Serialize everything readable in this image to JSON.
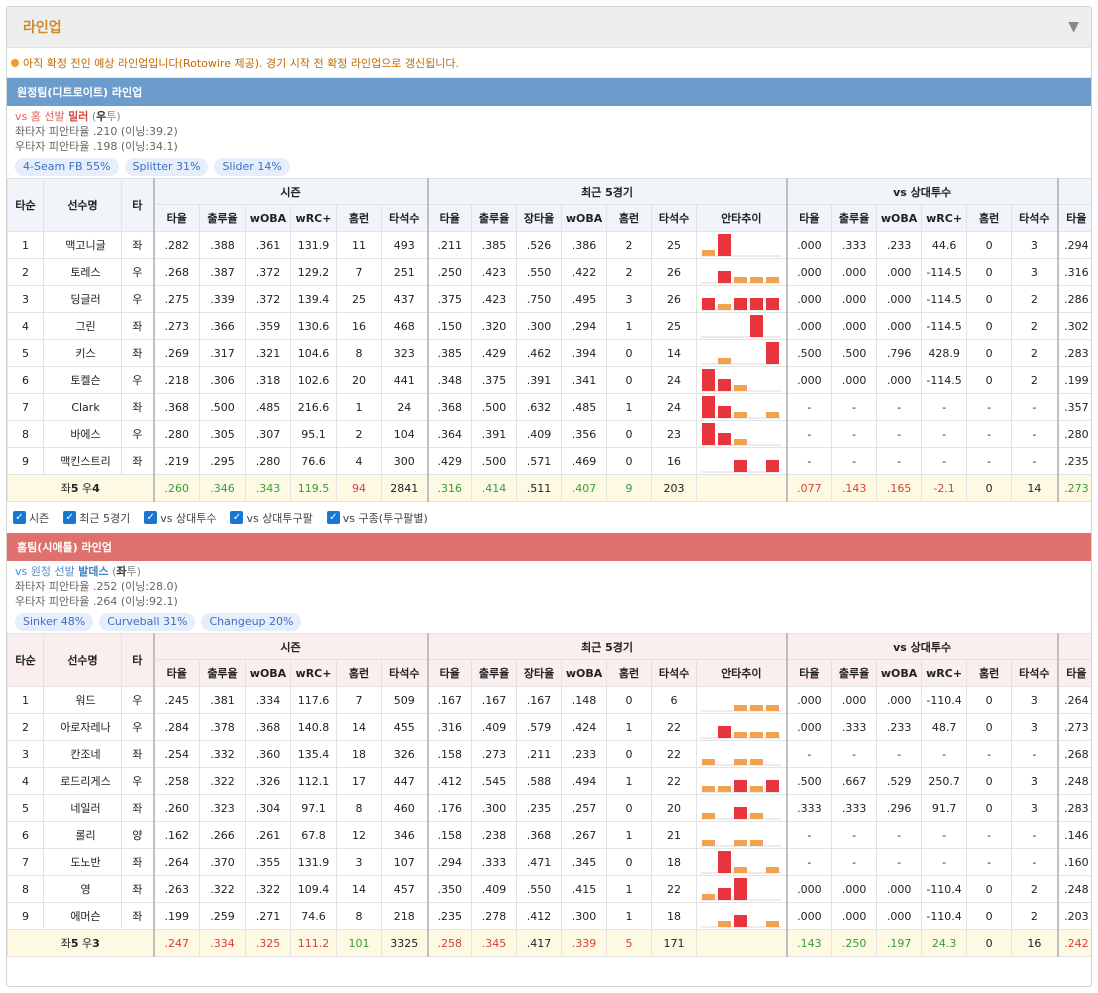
{
  "panel": {
    "title": "라인업",
    "collapse_icon": "▼"
  },
  "notice": "아직 확정 전인 예상 라인업입니다(Rotowire 제공). 경기 시작 전 확정 라인업으로 갱신됩니다.",
  "columns": {
    "group_season": "시즌",
    "group_recent": "최근 5경기",
    "group_vs": "vs 상대투수",
    "batorder": "타순",
    "name": "선수명",
    "hand": "타",
    "season": [
      "타율",
      "출루율",
      "wOBA",
      "wRC+",
      "홈런",
      "타석수"
    ],
    "recent": [
      "타율",
      "출루율",
      "장타율",
      "wOBA",
      "홈런",
      "타석수",
      "안타추이"
    ],
    "vs": [
      "타율",
      "출루율",
      "wOBA",
      "wRC+",
      "홈런",
      "타석수"
    ],
    "extra": "타율"
  },
  "toggles": [
    "시즌",
    "최근 5경기",
    "vs 상대투수",
    "vs 상대투구팔",
    "vs 구종(투구팔별)"
  ],
  "colors": {
    "bar_red": "#e8353b",
    "bar_orange": "#f0a24e",
    "away_bar": "#6b9ccb",
    "home_bar": "#e0706d"
  },
  "away": {
    "header": "원정팀(디트로이트) 라인업",
    "pitcher": {
      "vs": "vs 홈 선발",
      "name": "밀러",
      "hand_open": "(",
      "hand": "우",
      "hand_close": "투)",
      "line1": "좌타자 피안타율 .210 (이닝:39.2)",
      "line2": "우타자 피안타율 .198 (이닝:34.1)"
    },
    "chips": [
      "4-Seam FB 55%",
      "Splitter 31%",
      "Slider 14%"
    ],
    "rows": [
      {
        "o": "1",
        "n": "맥고니글",
        "h": "좌",
        "s": [
          ".282",
          ".388",
          ".361",
          "131.9",
          "11",
          "493"
        ],
        "r": [
          ".211",
          ".385",
          ".526",
          ".386",
          "2",
          "25"
        ],
        "t": [
          1,
          3,
          0,
          0,
          0
        ],
        "v": [
          ".000",
          ".333",
          ".233",
          "44.6",
          "0",
          "3"
        ],
        "x": ".294"
      },
      {
        "o": "2",
        "n": "토레스",
        "h": "우",
        "s": [
          ".268",
          ".387",
          ".372",
          "129.2",
          "7",
          "251"
        ],
        "r": [
          ".250",
          ".423",
          ".550",
          ".422",
          "2",
          "26"
        ],
        "t": [
          0,
          2,
          1,
          1,
          1
        ],
        "v": [
          ".000",
          ".000",
          ".000",
          "-114.5",
          "0",
          "3"
        ],
        "x": ".316"
      },
      {
        "o": "3",
        "n": "딩글러",
        "h": "우",
        "s": [
          ".275",
          ".339",
          ".372",
          "139.4",
          "25",
          "437"
        ],
        "r": [
          ".375",
          ".423",
          ".750",
          ".495",
          "3",
          "26"
        ],
        "t": [
          2,
          1,
          2,
          2,
          2
        ],
        "v": [
          ".000",
          ".000",
          ".000",
          "-114.5",
          "0",
          "2"
        ],
        "x": ".286"
      },
      {
        "o": "4",
        "n": "그린",
        "h": "좌",
        "s": [
          ".273",
          ".366",
          ".359",
          "130.6",
          "16",
          "468"
        ],
        "r": [
          ".150",
          ".320",
          ".300",
          ".294",
          "1",
          "25"
        ],
        "t": [
          0,
          0,
          0,
          3,
          0
        ],
        "v": [
          ".000",
          ".000",
          ".000",
          "-114.5",
          "0",
          "2"
        ],
        "x": ".302"
      },
      {
        "o": "5",
        "n": "키스",
        "h": "좌",
        "s": [
          ".269",
          ".317",
          ".321",
          "104.6",
          "8",
          "323"
        ],
        "r": [
          ".385",
          ".429",
          ".462",
          ".394",
          "0",
          "14"
        ],
        "t": [
          0,
          1,
          0,
          0,
          3
        ],
        "v": [
          ".500",
          ".500",
          ".796",
          "428.9",
          "0",
          "2"
        ],
        "x": ".283"
      },
      {
        "o": "6",
        "n": "토켈슨",
        "h": "우",
        "s": [
          ".218",
          ".306",
          ".318",
          "102.6",
          "20",
          "441"
        ],
        "r": [
          ".348",
          ".375",
          ".391",
          ".341",
          "0",
          "24"
        ],
        "t": [
          3,
          2,
          1,
          0,
          0
        ],
        "v": [
          ".000",
          ".000",
          ".000",
          "-114.5",
          "0",
          "2"
        ],
        "x": ".199"
      },
      {
        "o": "7",
        "n": "Clark",
        "h": "좌",
        "s": [
          ".368",
          ".500",
          ".485",
          "216.6",
          "1",
          "24"
        ],
        "r": [
          ".368",
          ".500",
          ".632",
          ".485",
          "1",
          "24"
        ],
        "t": [
          3,
          2,
          1,
          0,
          1
        ],
        "v": [
          "-",
          "-",
          "-",
          "-",
          "-",
          "-"
        ],
        "x": ".357"
      },
      {
        "o": "8",
        "n": "바에스",
        "h": "우",
        "s": [
          ".280",
          ".305",
          ".307",
          "95.1",
          "2",
          "104"
        ],
        "r": [
          ".364",
          ".391",
          ".409",
          ".356",
          "0",
          "23"
        ],
        "t": [
          3,
          2,
          1,
          0,
          0
        ],
        "v": [
          "-",
          "-",
          "-",
          "-",
          "-",
          "-"
        ],
        "x": ".280"
      },
      {
        "o": "9",
        "n": "맥킨스트리",
        "h": "좌",
        "s": [
          ".219",
          ".295",
          ".280",
          "76.6",
          "4",
          "300"
        ],
        "r": [
          ".429",
          ".500",
          ".571",
          ".469",
          "0",
          "16"
        ],
        "t": [
          0,
          0,
          2,
          0,
          2
        ],
        "v": [
          "-",
          "-",
          "-",
          "-",
          "-",
          "-"
        ],
        "x": ".235"
      }
    ],
    "summary": {
      "label_pre": "좌",
      "left": "5",
      "label_mid": " 우",
      "right": "4",
      "s": [
        ".260",
        ".346",
        ".343",
        "119.5",
        "94",
        "2841"
      ],
      "r": [
        ".316",
        ".414",
        ".511",
        ".407",
        "9",
        "203"
      ],
      "v": [
        ".077",
        ".143",
        ".165",
        "-2.1",
        "0",
        "14"
      ],
      "x": ".273"
    }
  },
  "home": {
    "header": "홈팀(시애틀) 라인업",
    "pitcher": {
      "vs": "vs 원정 선발",
      "name": "발데스",
      "hand_open": "(",
      "hand": "좌",
      "hand_close": "투)",
      "line1": "좌타자 피안타율 .252 (이닝:28.0)",
      "line2": "우타자 피안타율 .264 (이닝:92.1)"
    },
    "chips": [
      "Sinker 48%",
      "Curveball 31%",
      "Changeup 20%"
    ],
    "rows": [
      {
        "o": "1",
        "n": "워드",
        "h": "우",
        "s": [
          ".245",
          ".381",
          ".334",
          "117.6",
          "7",
          "509"
        ],
        "r": [
          ".167",
          ".167",
          ".167",
          ".148",
          "0",
          "6"
        ],
        "t": [
          0,
          0,
          1,
          1,
          1
        ],
        "v": [
          ".000",
          ".000",
          ".000",
          "-110.4",
          "0",
          "3"
        ],
        "x": ".264"
      },
      {
        "o": "2",
        "n": "아로자레나",
        "h": "우",
        "s": [
          ".284",
          ".378",
          ".368",
          "140.8",
          "14",
          "455"
        ],
        "r": [
          ".316",
          ".409",
          ".579",
          ".424",
          "1",
          "22"
        ],
        "t": [
          0,
          2,
          1,
          1,
          1
        ],
        "v": [
          ".000",
          ".333",
          ".233",
          "48.7",
          "0",
          "3"
        ],
        "x": ".273"
      },
      {
        "o": "3",
        "n": "칸조네",
        "h": "좌",
        "s": [
          ".254",
          ".332",
          ".360",
          "135.4",
          "18",
          "326"
        ],
        "r": [
          ".158",
          ".273",
          ".211",
          ".233",
          "0",
          "22"
        ],
        "t": [
          1,
          0,
          1,
          1,
          0
        ],
        "v": [
          "-",
          "-",
          "-",
          "-",
          "-",
          "-"
        ],
        "x": ".268"
      },
      {
        "o": "4",
        "n": "로드리게스",
        "h": "우",
        "s": [
          ".258",
          ".322",
          ".326",
          "112.1",
          "17",
          "447"
        ],
        "r": [
          ".412",
          ".545",
          ".588",
          ".494",
          "1",
          "22"
        ],
        "t": [
          1,
          1,
          2,
          1,
          2
        ],
        "v": [
          ".500",
          ".667",
          ".529",
          "250.7",
          "0",
          "3"
        ],
        "x": ".248"
      },
      {
        "o": "5",
        "n": "네일러",
        "h": "좌",
        "s": [
          ".260",
          ".323",
          ".304",
          "97.1",
          "8",
          "460"
        ],
        "r": [
          ".176",
          ".300",
          ".235",
          ".257",
          "0",
          "20"
        ],
        "t": [
          1,
          0,
          2,
          1,
          0
        ],
        "v": [
          ".333",
          ".333",
          ".296",
          "91.7",
          "0",
          "3"
        ],
        "x": ".283"
      },
      {
        "o": "6",
        "n": "롤리",
        "h": "양",
        "s": [
          ".162",
          ".266",
          ".261",
          "67.8",
          "12",
          "346"
        ],
        "r": [
          ".158",
          ".238",
          ".368",
          ".267",
          "1",
          "21"
        ],
        "t": [
          1,
          0,
          1,
          1,
          0
        ],
        "v": [
          "-",
          "-",
          "-",
          "-",
          "-",
          "-"
        ],
        "x": ".146"
      },
      {
        "o": "7",
        "n": "도노반",
        "h": "좌",
        "s": [
          ".264",
          ".370",
          ".355",
          "131.9",
          "3",
          "107"
        ],
        "r": [
          ".294",
          ".333",
          ".471",
          ".345",
          "0",
          "18"
        ],
        "t": [
          0,
          3,
          1,
          0,
          1
        ],
        "v": [
          "-",
          "-",
          "-",
          "-",
          "-",
          "-"
        ],
        "x": ".160"
      },
      {
        "o": "8",
        "n": "영",
        "h": "좌",
        "s": [
          ".263",
          ".322",
          ".322",
          "109.4",
          "14",
          "457"
        ],
        "r": [
          ".350",
          ".409",
          ".550",
          ".415",
          "1",
          "22"
        ],
        "t": [
          1,
          2,
          3,
          0,
          0
        ],
        "v": [
          ".000",
          ".000",
          ".000",
          "-110.4",
          "0",
          "2"
        ],
        "x": ".248"
      },
      {
        "o": "9",
        "n": "에머슨",
        "h": "좌",
        "s": [
          ".199",
          ".259",
          ".271",
          "74.6",
          "8",
          "218"
        ],
        "r": [
          ".235",
          ".278",
          ".412",
          ".300",
          "1",
          "18"
        ],
        "t": [
          0,
          1,
          2,
          0,
          1
        ],
        "v": [
          ".000",
          ".000",
          ".000",
          "-110.4",
          "0",
          "2"
        ],
        "x": ".203"
      }
    ],
    "summary": {
      "label_pre": "좌",
      "left": "5",
      "label_mid": " 우",
      "right": "3",
      "s": [
        ".247",
        ".334",
        ".325",
        "111.2",
        "101",
        "3325"
      ],
      "r": [
        ".258",
        ".345",
        ".417",
        ".339",
        "5",
        "171"
      ],
      "v": [
        ".143",
        ".250",
        ".197",
        "24.3",
        "0",
        "16"
      ],
      "x": ".242"
    }
  }
}
